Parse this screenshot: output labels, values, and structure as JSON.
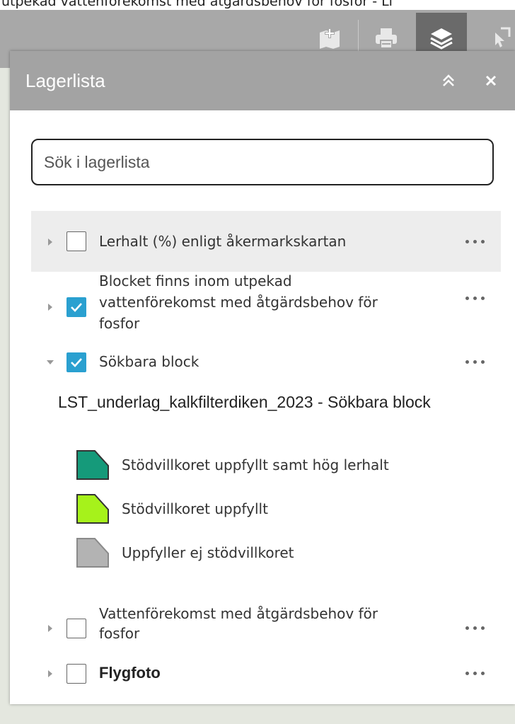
{
  "caption": "utpekad vattenförekomst med åtgärdsbehov för fosfor - Li",
  "toolbar": {
    "tools": [
      {
        "icon": "add-map-icon",
        "active": false
      },
      {
        "icon": "print-icon",
        "active": false
      },
      {
        "icon": "layers-icon",
        "active": true
      },
      {
        "icon": "select-icon",
        "active": false
      }
    ]
  },
  "panel": {
    "title": "Lagerlista",
    "collapse_icon": "double-chevron-up-icon",
    "close_icon": "close-icon"
  },
  "search": {
    "placeholder": "Sök i lagerlista",
    "value": ""
  },
  "layers": [
    {
      "label": "Lerhalt (%) enligt åkermarkskartan",
      "checked": false,
      "expanded": false
    },
    {
      "label_lines": [
        "Blocket finns inom utpekad",
        "vattenförekomst med åtgärdsbehov för",
        "fosfor"
      ],
      "checked": true,
      "expanded": false
    },
    {
      "label": "Sökbara block",
      "checked": true,
      "expanded": true
    },
    {
      "label_lines": [
        "Vattenförekomst med åtgärdsbehov för",
        "fosfor"
      ],
      "checked": false,
      "expanded": false
    },
    {
      "label": "Flygfoto",
      "checked": false,
      "expanded": false
    }
  ],
  "legend": {
    "title": "LST_underlag_kalkfilterdiken_2023 - Sökbara block",
    "items": [
      {
        "label": "Stödvillkoret uppfyllt samt hög lerhalt",
        "color": "#159a7a"
      },
      {
        "label": "Stödvillkoret uppfyllt",
        "color": "#a6f21b"
      },
      {
        "label": "Uppfyller ej stödvillkoret",
        "color": "#b3b3b3"
      }
    ]
  },
  "colors": {
    "header": "#a3a3a3",
    "accent": "#2aa0d0",
    "active_tool": "#6a6a6a"
  }
}
